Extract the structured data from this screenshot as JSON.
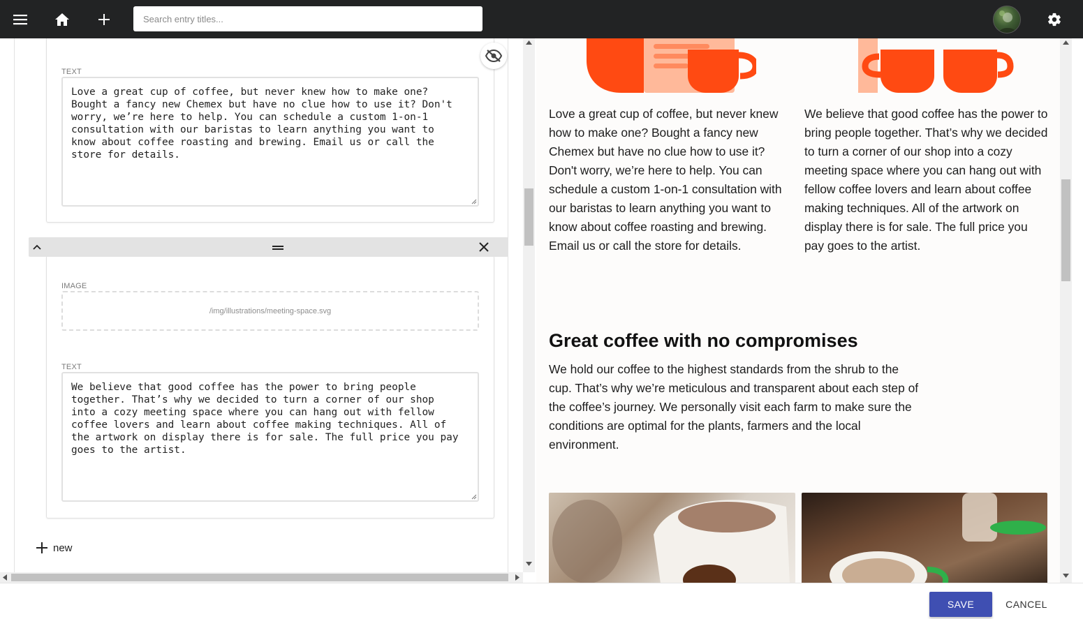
{
  "topbar": {
    "menu_icon": "hamburger-menu-icon",
    "home_icon": "home-icon",
    "add_icon": "plus-icon",
    "search_placeholder": "Search entry titles...",
    "settings_icon": "gear-icon",
    "background": "#222324"
  },
  "editor": {
    "block1": {
      "text_label": "TEXT",
      "text_value": "Love a great cup of coffee, but never knew how to make one?\nBought a fancy new Chemex but have no clue how to use it? Don't\nworry, we’re here to help. You can schedule a custom 1-on-1\nconsultation with our baristas to learn anything you want to\nknow about coffee roasting and brewing. Email us or call the\nstore for details."
    },
    "block2": {
      "image_label": "IMAGE",
      "image_value": "/img/illustrations/meeting-space.svg",
      "text_label": "TEXT",
      "text_value": "We believe that good coffee has the power to bring people\ntogether. That’s why we decided to turn a corner of our shop\ninto a cozy meeting space where you can hang out with fellow\ncoffee lovers and learn about coffee making techniques. All of\nthe artwork on display there is for sale. The full price you pay\ngoes to the artist."
    },
    "new_label": "new"
  },
  "preview": {
    "col1": "Love a great cup of coffee, but never knew how to make one? Bought a fancy new Chemex but have no clue how to use it? Don't worry, we’re here to help. You can schedule a custom 1-on-1 consultation with our baristas to learn anything you want to know about coffee roasting and brewing. Email us or call the store for details.",
    "col2": "We believe that good coffee has the power to bring people together. That’s why we decided to turn a corner of our shop into a cozy meeting space where you can hang out with fellow coffee lovers and learn about coffee making techniques. All of the artwork on display there is for sale. The full price you pay goes to the artist.",
    "heading": "Great coffee with no compromises",
    "paragraph": "We hold our coffee to the highest standards from the shrub to the cup. That’s why we’re meticulous and transparent about each step of the coffee’s journey. We personally visit each farm to make sure the conditions are optimal for the plants, farmers and the local environment.",
    "illustration_color": "#ff4a12",
    "illustration_light_color": "#ffb99a"
  },
  "actions": {
    "save": "SAVE",
    "cancel": "CANCEL",
    "save_color": "#3f4fb2"
  }
}
